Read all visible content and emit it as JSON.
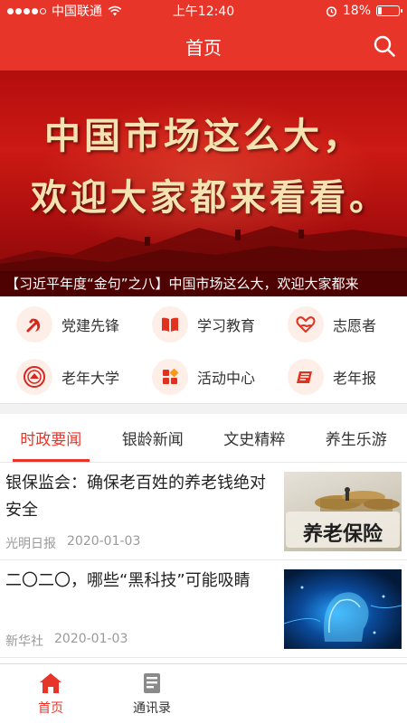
{
  "status_bar": {
    "carrier": "中国联通",
    "time": "上午12:40",
    "battery": "18%",
    "battery_level": 0.18
  },
  "header": {
    "title": "首页",
    "search_icon": "search-icon"
  },
  "banner": {
    "line1": "中国市场这么大，",
    "line2": "欢迎大家都来看看。",
    "caption": "【习近平年度“金句”之八】中国市场这么大，欢迎大家都来"
  },
  "quick_links": [
    {
      "label": "党建先锋",
      "icon": "party-emblem-icon"
    },
    {
      "label": "学习教育",
      "icon": "book-icon"
    },
    {
      "label": "志愿者",
      "icon": "heart-hand-icon"
    },
    {
      "label": "老年大学",
      "icon": "university-emblem-icon"
    },
    {
      "label": "活动中心",
      "icon": "grid-icon"
    },
    {
      "label": "老年报",
      "icon": "newspaper-icon"
    }
  ],
  "news_tabs": [
    {
      "label": "时政要闻",
      "active": true
    },
    {
      "label": "银龄新闻",
      "active": false
    },
    {
      "label": "文史精粹",
      "active": false
    },
    {
      "label": "养生乐游",
      "active": false
    }
  ],
  "news": [
    {
      "title": "银保监会：确保老百姓的养老钱绝对安全",
      "source": "光明日报",
      "date": "2020-01-03",
      "thumb_text": "养老保险"
    },
    {
      "title": "二〇二〇，哪些“黑科技”可能吸睛",
      "source": "新华社",
      "date": "2020-01-03"
    }
  ],
  "bottom_nav": [
    {
      "label": "首页",
      "icon": "home-icon",
      "active": true
    },
    {
      "label": "通讯录",
      "icon": "contacts-icon",
      "active": false
    }
  ],
  "colors": {
    "primary": "#e8352a",
    "banner_text": "#f4e3b0"
  }
}
